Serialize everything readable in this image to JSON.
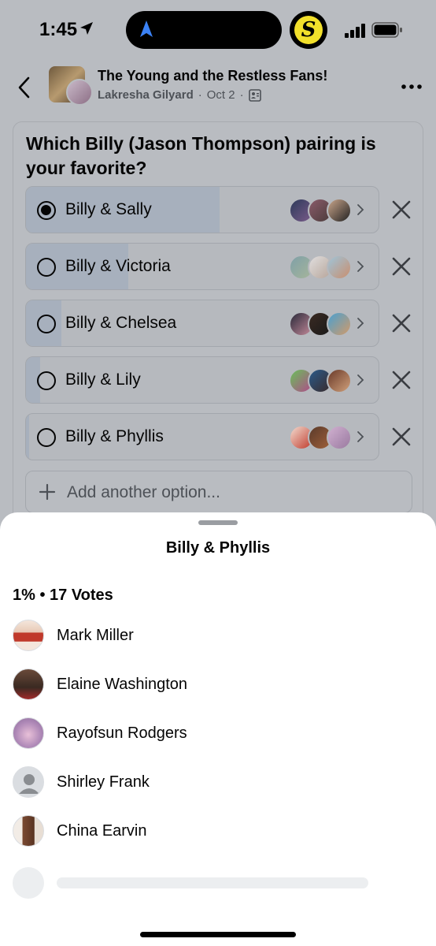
{
  "status_bar": {
    "time": "1:45",
    "app_badge_letter": "S",
    "icons": [
      "location-arrow-icon",
      "navigation-icon",
      "cellular-signal-icon",
      "battery-icon"
    ]
  },
  "header": {
    "group_name": "The Young and the Restless Fans!",
    "author": "Lakresha Gilyard",
    "date": "Oct 2",
    "separator": "·",
    "icons": [
      "back-chevron-icon",
      "group-privacy-icon",
      "more-options-icon"
    ]
  },
  "poll": {
    "question": "Which Billy (Jason Thompson) pairing is your favorite?",
    "options": [
      {
        "label": "Billy & Sally",
        "selected": true,
        "share": 0.55
      },
      {
        "label": "Billy & Victoria",
        "selected": false,
        "share": 0.29
      },
      {
        "label": "Billy & Chelsea",
        "selected": false,
        "share": 0.1
      },
      {
        "label": "Billy & Lily",
        "selected": false,
        "share": 0.04
      },
      {
        "label": "Billy & Phyllis",
        "selected": false,
        "share": 0.01
      }
    ],
    "add_option_label": "Add another option..."
  },
  "sheet": {
    "title": "Billy & Phyllis",
    "summary": "1% • 17 Votes",
    "voters": [
      {
        "name": "Mark Miller"
      },
      {
        "name": "Elaine Washington"
      },
      {
        "name": "Rayofsun Rodgers"
      },
      {
        "name": "Shirley Frank"
      },
      {
        "name": "China Earvin"
      }
    ]
  },
  "colors": {
    "dim_overlay": "#b9bcc1",
    "sheet_bg": "#ffffff",
    "poll_fill": "#a7b0bd",
    "text_primary": "#050505",
    "text_secondary": "#4d5157"
  }
}
